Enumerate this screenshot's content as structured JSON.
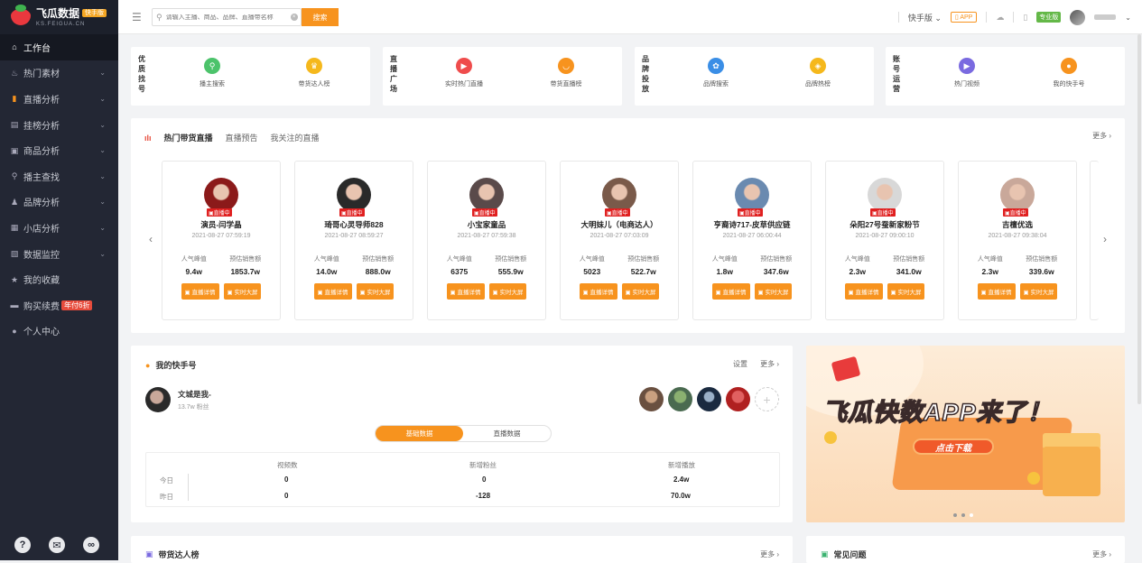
{
  "brand": {
    "name": "飞瓜数据",
    "tag": "快手版",
    "sub": "KS.FEIGUA.CN"
  },
  "sidebar": {
    "items": [
      {
        "label": "工作台",
        "icon": "home-icon",
        "glyph": "⌂",
        "active": true,
        "chev": false
      },
      {
        "label": "热门素材",
        "icon": "fire-icon",
        "glyph": "♨",
        "chev": true
      },
      {
        "label": "直播分析",
        "icon": "bar-chart-icon",
        "glyph": "▮",
        "chev": true,
        "orange": true
      },
      {
        "label": "挂榜分析",
        "icon": "ranking-icon",
        "glyph": "▤",
        "chev": true
      },
      {
        "label": "商品分析",
        "icon": "goods-icon",
        "glyph": "▣",
        "chev": true
      },
      {
        "label": "播主查找",
        "icon": "search-icon",
        "glyph": "⚲",
        "chev": true
      },
      {
        "label": "品牌分析",
        "icon": "brand-icon",
        "glyph": "♟",
        "chev": true
      },
      {
        "label": "小店分析",
        "icon": "store-icon",
        "glyph": "▦",
        "chev": true
      },
      {
        "label": "数据监控",
        "icon": "monitor-icon",
        "glyph": "▧",
        "chev": true
      },
      {
        "label": "我的收藏",
        "icon": "star-icon",
        "glyph": "★",
        "chev": false
      },
      {
        "label": "购买续费",
        "icon": "card-icon",
        "glyph": "▬",
        "chev": false,
        "badge": "年付6折"
      },
      {
        "label": "个人中心",
        "icon": "user-icon",
        "glyph": "●",
        "chev": false
      }
    ],
    "footer": [
      "?",
      "✉",
      "∞"
    ]
  },
  "search": {
    "placeholder": "请输入主播、商品、品牌、直播带名称",
    "button": "搜索"
  },
  "topbar": {
    "version": "快手版 ⌄",
    "app": "▯ APP",
    "pro": "专业版"
  },
  "quick": [
    {
      "label": "优质找号",
      "items": [
        {
          "text": "播主搜索",
          "color": "#4cc36b",
          "glyph": "⚲"
        },
        {
          "text": "带货达人榜",
          "color": "#f5b81c",
          "glyph": "♛"
        }
      ]
    },
    {
      "label": "直播广场",
      "items": [
        {
          "text": "实时热门直播",
          "color": "#ef4c4c",
          "glyph": "▶"
        },
        {
          "text": "带货直播榜",
          "color": "#f7931e",
          "glyph": "◡"
        }
      ]
    },
    {
      "label": "品牌投放",
      "items": [
        {
          "text": "品牌搜索",
          "color": "#3a8ee6",
          "glyph": "✿"
        },
        {
          "text": "品牌热榜",
          "color": "#f5b81c",
          "glyph": "◈"
        }
      ]
    },
    {
      "label": "账号运营",
      "items": [
        {
          "text": "热门视频",
          "color": "#7a6ae0",
          "glyph": "▶"
        },
        {
          "text": "我的快手号",
          "color": "#f7931e",
          "glyph": "●"
        }
      ]
    }
  ],
  "hot": {
    "tabs": [
      "热门带货直播",
      "直播预告",
      "我关注的直播"
    ],
    "more": "更多 ›",
    "live_label": "直播中",
    "stat_labels": [
      "人气峰值",
      "预估销售额"
    ],
    "btns": [
      "直播详情",
      "实时大屏"
    ],
    "streamers": [
      {
        "name": "演员-闫学晶",
        "time": "2021-08-27 07:59:19",
        "peak": "9.4w",
        "sales": "1853.7w",
        "bg": "#8b1a1a"
      },
      {
        "name": "琦哥心灵导师828",
        "time": "2021-08-27 08:59:27",
        "peak": "14.0w",
        "sales": "888.0w",
        "bg": "#2a2a2a"
      },
      {
        "name": "小宝家童品",
        "time": "2021-08-27 07:59:38",
        "peak": "6375",
        "sales": "555.9w",
        "bg": "#5a4a4a"
      },
      {
        "name": "大明妹儿（电商达人）",
        "time": "2021-08-27 07:03:09",
        "peak": "5023",
        "sales": "522.7w",
        "bg": "#7a5a4a"
      },
      {
        "name": "亨裔诗717-皮草供应链",
        "time": "2021-08-27 06:00:44",
        "peak": "1.8w",
        "sales": "347.6w",
        "bg": "#6a8ab0"
      },
      {
        "name": "朵阳27号蚕新家粉节",
        "time": "2021-08-27 09:00:10",
        "peak": "2.3w",
        "sales": "341.0w",
        "bg": "#d8d8d8"
      },
      {
        "name": "吉檀优选",
        "time": "2021-08-27 09:38:04",
        "peak": "2.3w",
        "sales": "339.6w",
        "bg": "#c9a89a"
      }
    ]
  },
  "mine": {
    "title": "我的快手号",
    "settings": "设置",
    "more": "更多 ›",
    "name": "文城是我-",
    "fans": "13.7w 粉丝",
    "tabs": [
      "基础数据",
      "直播数据"
    ],
    "headers": [
      "视频数",
      "新增粉丝",
      "新增播放"
    ],
    "rows": [
      {
        "label": "今日",
        "values": [
          "0",
          "0",
          "2.4w"
        ]
      },
      {
        "label": "昨日",
        "values": [
          "0",
          "-128",
          "70.0w"
        ]
      }
    ]
  },
  "banner": {
    "title": "飞瓜快数APP来了！",
    "button": "点击下载"
  },
  "bottom": {
    "left_title": "带货达人榜",
    "left_more": "更多 ›",
    "right_title": "常见问题",
    "right_more": "更多 ›"
  }
}
